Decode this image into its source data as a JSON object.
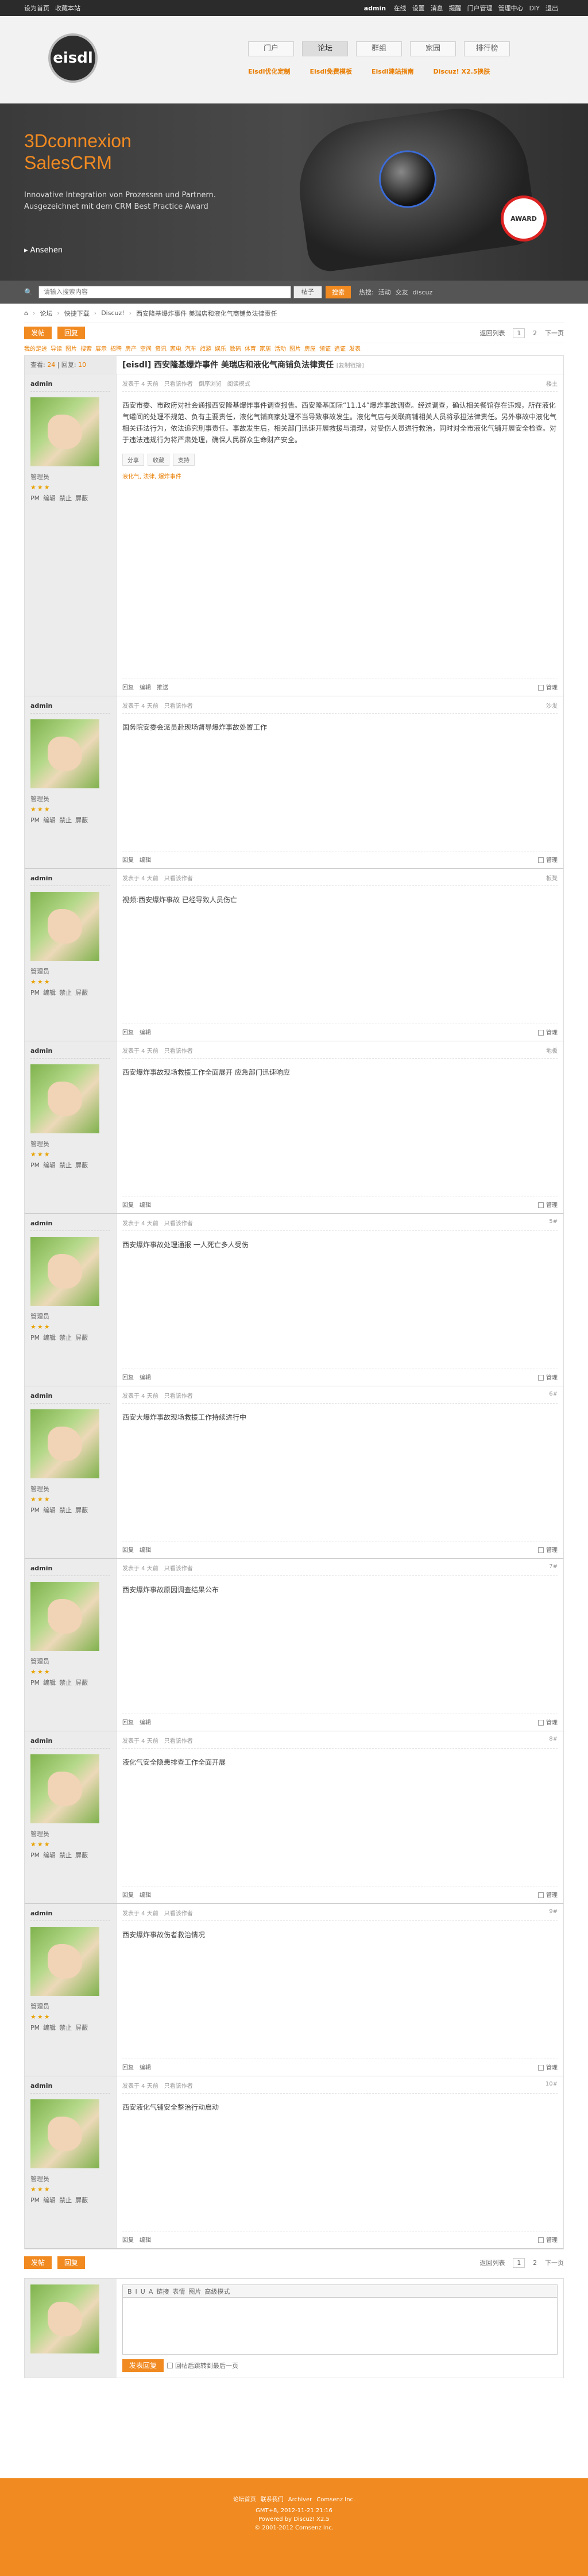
{
  "topbar": {
    "left": [
      "设为首页",
      "收藏本站"
    ],
    "user": "admin",
    "right": [
      "在线",
      "设置",
      "消息",
      "提醒",
      "门户管理",
      "管理中心",
      "DIY",
      "退出"
    ]
  },
  "header": {
    "logo": "eisdl",
    "nav": [
      "门户",
      "论坛",
      "群组",
      "家园",
      "排行榜"
    ],
    "subnav": [
      "Eisdl优化定制",
      "Eisdl免费模板",
      "Eisdl建站指南",
      "Discuz! X2.5换肤"
    ]
  },
  "banner": {
    "title": "3Dconnexion SalesCRM",
    "desc": "Innovative Integration von Prozessen und Partnern. Ausgezeichnet mit dem CRM Best Practice Award",
    "more": "Ansehen",
    "award": "AWARD"
  },
  "search": {
    "placeholder": "请输入搜索内容",
    "type": "帖子",
    "button": "搜索",
    "hot_label": "热搜:",
    "hot": [
      "活动",
      "交友",
      "discuz"
    ]
  },
  "crumb": [
    "论坛",
    "快捷下载",
    "Discuz!",
    "西安隆基爆炸事件 美瑞店和液化气商铺负法律责任"
  ],
  "pager": {
    "new_post": "发帖",
    "reply": "回复",
    "prev": "返回列表",
    "pages": [
      "1",
      "2"
    ],
    "next": "下一页"
  },
  "forumlinks": [
    "我的足迹",
    "导读",
    "图片",
    "搜索",
    "展示",
    "招聘",
    "房产",
    "空间",
    "资讯",
    "家电",
    "汽车",
    "旅游",
    "娱乐",
    "数码",
    "体育",
    "家居",
    "活动",
    "图片",
    "房屋",
    "领证",
    "追证",
    "发表"
  ],
  "thread": {
    "views_label": "查看",
    "views": "24",
    "replies_label": "回复",
    "replies": "10",
    "title": "[eisdl] 西安隆基爆炸事件 美瑞店和液化气商铺负法律责任",
    "copy": "[复制链接]"
  },
  "posts": [
    {
      "user": "admin",
      "role": "管理员",
      "stars": "★★★",
      "meta": [
        "发表于 4 天前",
        "只看该作者",
        "倒序浏览",
        "阅读模式"
      ],
      "floor": "楼主",
      "body": "西安市委、市政府对社会通报西安隆基爆炸事件调查报告。西安隆基国际“11.14”爆炸事故调查。经过调查，确认相关餐馆存在违规，所在液化气罐间的处理不规范、负有主要责任，液化气铺商家处理不当导致事故发生。液化气店与关联商铺相关人员将承担法律责任。另外事故中液化气相关违法行为，依法追究刑事责任。事故发生后，相关部门迅速开展救援与清理，对受伤人员进行救治，同时对全市液化气铺开展安全检查。对于违法违规行为将严肃处理，确保人民群众生命财产安全。",
      "share": [
        "分享",
        "收藏",
        "支持"
      ],
      "tags": "液化气, 法律, 爆炸事件",
      "foot": [
        "回复",
        "编辑",
        "推送"
      ],
      "manage": "管理"
    },
    {
      "user": "admin",
      "role": "管理员",
      "stars": "★★★",
      "meta": [
        "发表于 4 天前",
        "只看该作者"
      ],
      "floor": "沙发",
      "body": "国务院安委会派员赴现场督导爆炸事故处置工作",
      "foot": [
        "回复",
        "编辑"
      ],
      "manage": "管理"
    },
    {
      "user": "admin",
      "role": "管理员",
      "stars": "★★★",
      "meta": [
        "发表于 4 天前",
        "只看该作者"
      ],
      "floor": "板凳",
      "body": "视频:西安爆炸事故 已经导致人员伤亡",
      "foot": [
        "回复",
        "编辑"
      ],
      "manage": "管理"
    },
    {
      "user": "admin",
      "role": "管理员",
      "stars": "★★★",
      "meta": [
        "发表于 4 天前",
        "只看该作者"
      ],
      "floor": "地板",
      "body": "西安爆炸事故现场救援工作全面展开 应急部门迅速响应",
      "foot": [
        "回复",
        "编辑"
      ],
      "manage": "管理"
    },
    {
      "user": "admin",
      "role": "管理员",
      "stars": "★★★",
      "meta": [
        "发表于 4 天前",
        "只看该作者"
      ],
      "floor": "5#",
      "body": "西安爆炸事故处理通报 一人死亡多人受伤",
      "foot": [
        "回复",
        "编辑"
      ],
      "manage": "管理"
    },
    {
      "user": "admin",
      "role": "管理员",
      "stars": "★★★",
      "meta": [
        "发表于 4 天前",
        "只看该作者"
      ],
      "floor": "6#",
      "body": "西安大爆炸事故现场救援工作持续进行中",
      "foot": [
        "回复",
        "编辑"
      ],
      "manage": "管理"
    },
    {
      "user": "admin",
      "role": "管理员",
      "stars": "★★★",
      "meta": [
        "发表于 4 天前",
        "只看该作者"
      ],
      "floor": "7#",
      "body": "西安爆炸事故原因调查结果公布",
      "foot": [
        "回复",
        "编辑"
      ],
      "manage": "管理"
    },
    {
      "user": "admin",
      "role": "管理员",
      "stars": "★★★",
      "meta": [
        "发表于 4 天前",
        "只看该作者"
      ],
      "floor": "8#",
      "body": "液化气安全隐患排查工作全面开展",
      "foot": [
        "回复",
        "编辑"
      ],
      "manage": "管理"
    },
    {
      "user": "admin",
      "role": "管理员",
      "stars": "★★★",
      "meta": [
        "发表于 4 天前",
        "只看该作者"
      ],
      "floor": "9#",
      "body": "西安爆炸事故伤者救治情况",
      "foot": [
        "回复",
        "编辑"
      ],
      "manage": "管理"
    },
    {
      "user": "admin",
      "role": "管理员",
      "stars": "★★★",
      "meta": [
        "发表于 4 天前",
        "只看该作者"
      ],
      "floor": "10#",
      "body": "西安液化气铺安全整治行动启动",
      "foot": [
        "回复",
        "编辑"
      ],
      "manage": "管理"
    }
  ],
  "reply": {
    "tools": [
      "B",
      "I",
      "U",
      "A",
      "链接",
      "表情",
      "图片",
      "高级模式"
    ],
    "submit": "发表回复",
    "check": "回帖后跳转到最后一页"
  },
  "footer": {
    "links": [
      "论坛首页",
      "联系我们",
      "Archiver",
      "Comsenz Inc."
    ],
    "line1": "GMT+8, 2012-11-21 21:16",
    "line2": "Powered by Discuz! X2.5",
    "line3": "© 2001-2012 Comsenz Inc."
  }
}
